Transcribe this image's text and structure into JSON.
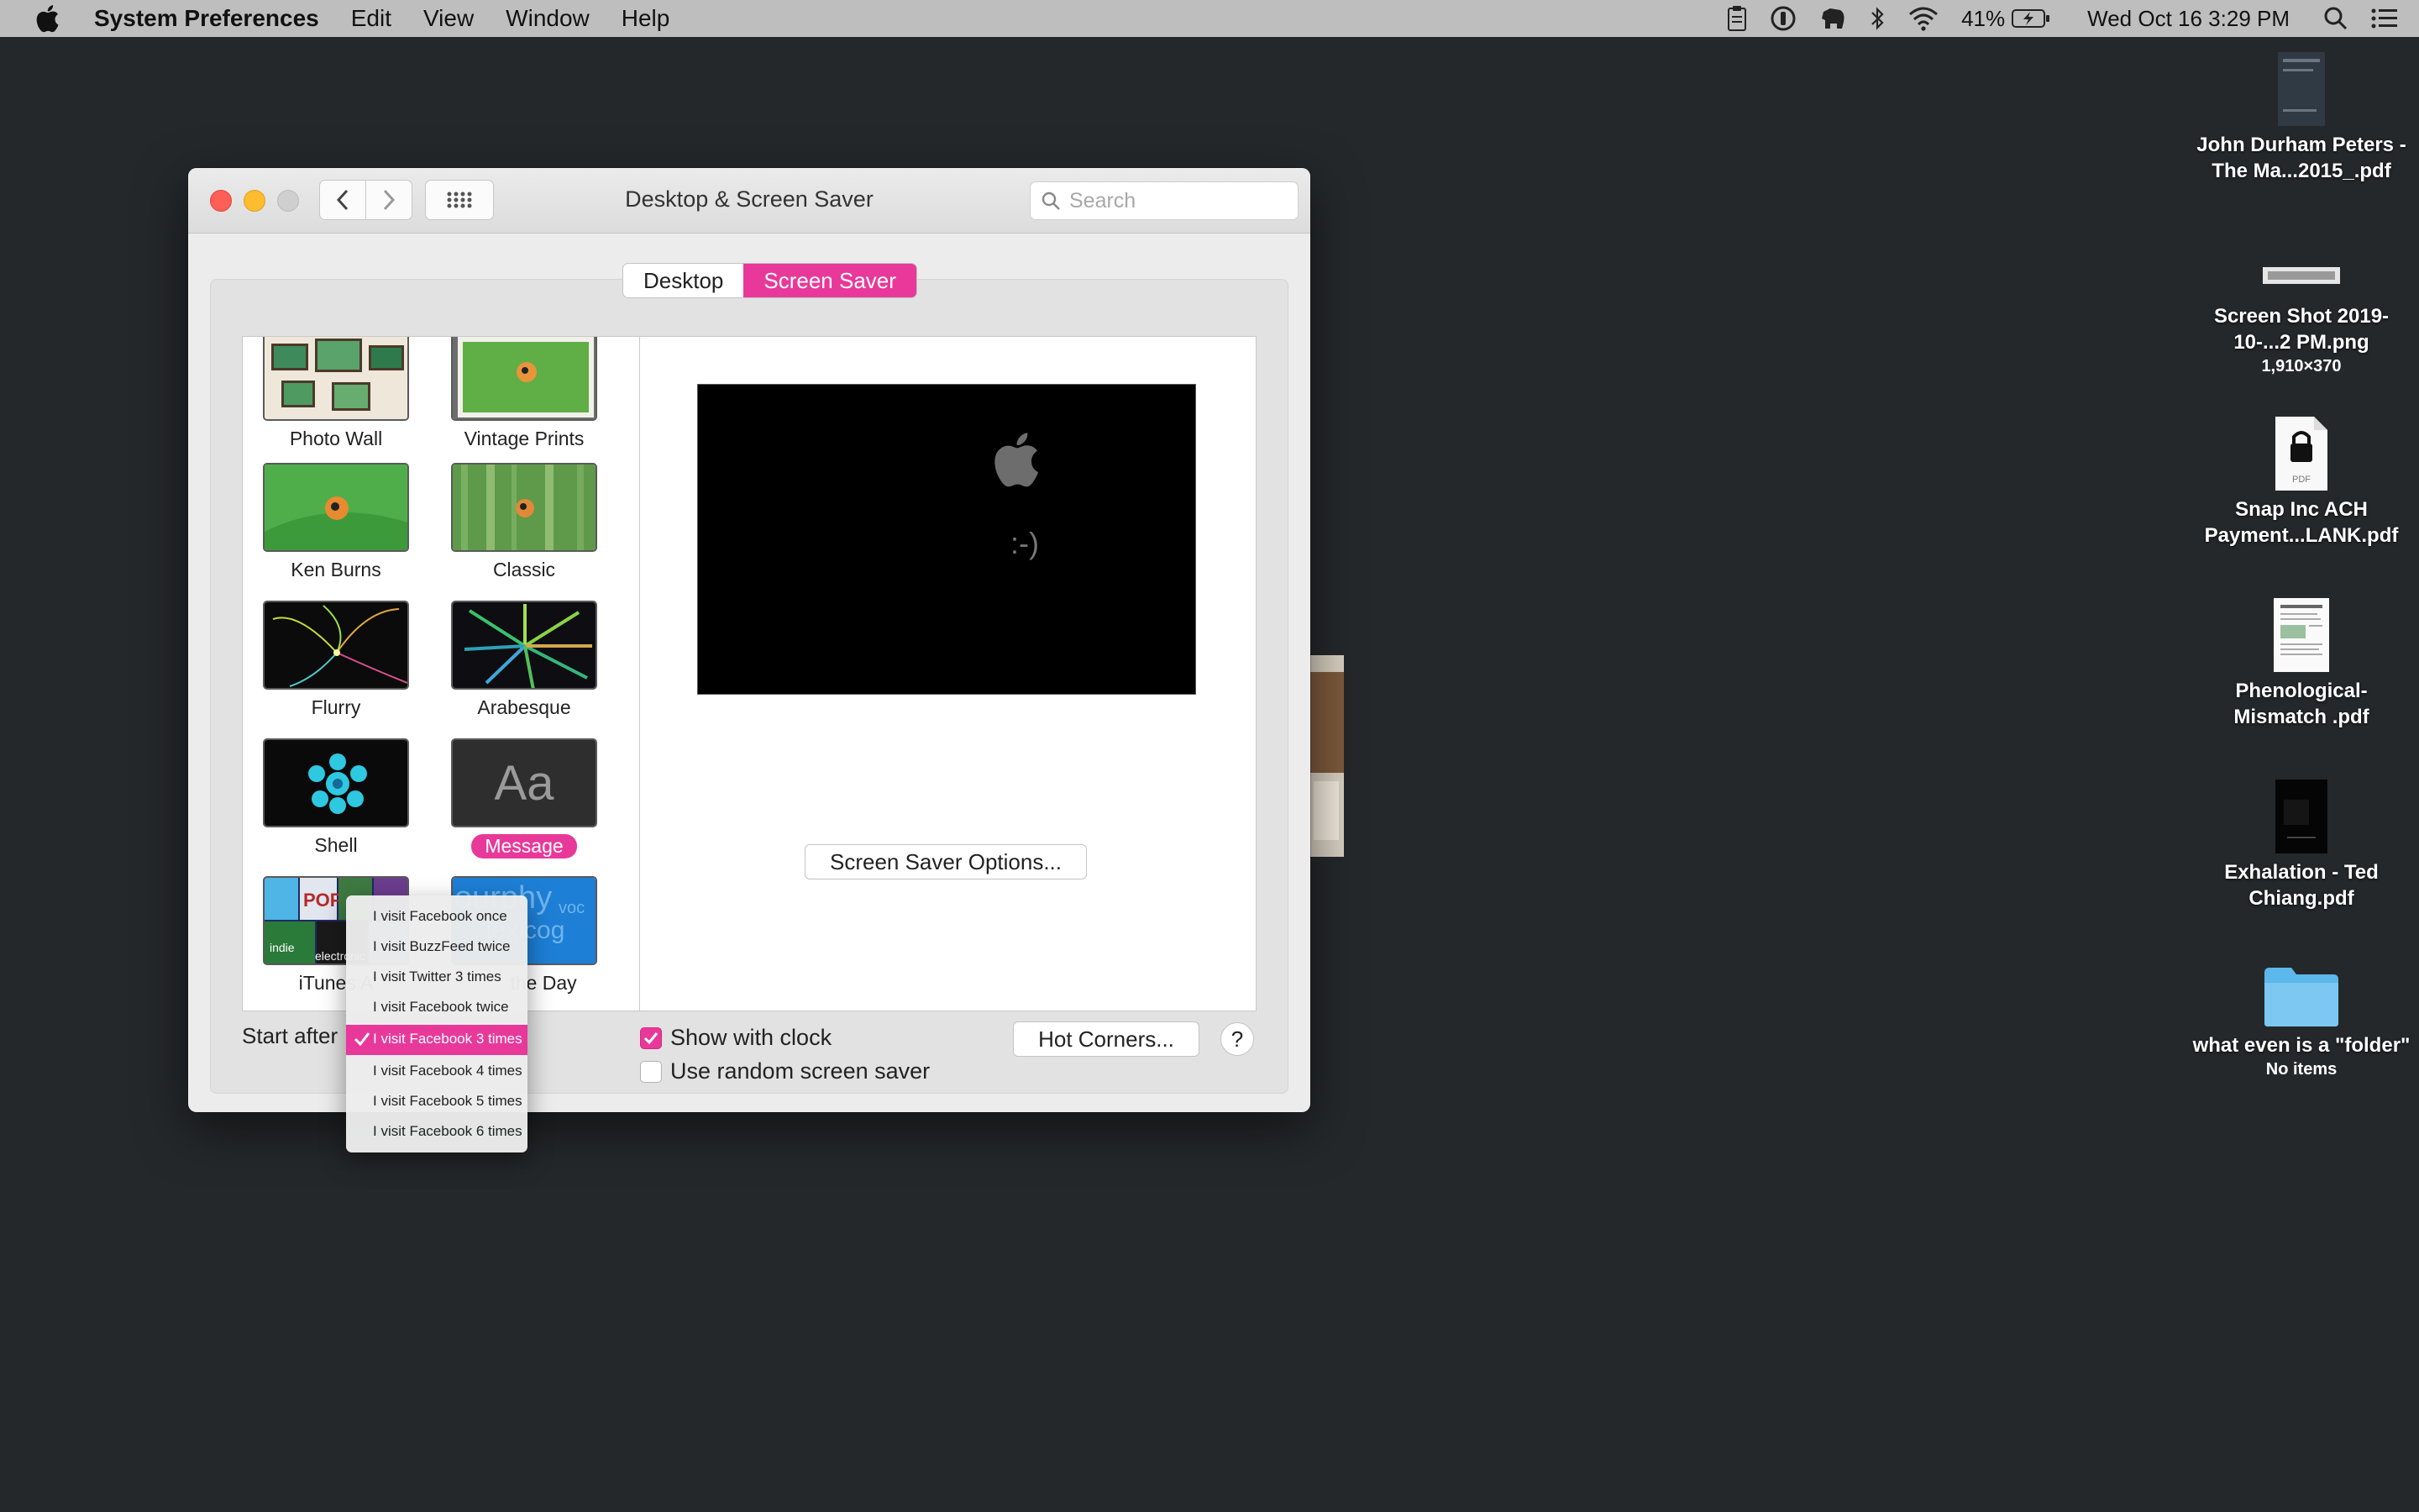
{
  "menubar": {
    "app_name": "System Preferences",
    "menus": [
      "Edit",
      "View",
      "Window",
      "Help"
    ],
    "battery": "41%",
    "datetime": "Wed Oct 16  3:29 PM"
  },
  "window": {
    "title": "Desktop & Screen Saver",
    "search_placeholder": "Search",
    "tabs": [
      {
        "label": "Desktop",
        "active": false
      },
      {
        "label": "Screen Saver",
        "active": true
      }
    ],
    "screensavers": [
      {
        "label": "Photo Wall"
      },
      {
        "label": "Vintage Prints"
      },
      {
        "label": "Ken Burns"
      },
      {
        "label": "Classic"
      },
      {
        "label": "Flurry"
      },
      {
        "label": "Arabesque"
      },
      {
        "label": "Shell"
      },
      {
        "label": "Message",
        "selected": true
      },
      {
        "label": "iTunes A"
      },
      {
        "label": "the Day"
      }
    ],
    "message_thumb_text": "Aa",
    "preview_message": ":-)",
    "options_button": "Screen Saver Options...",
    "start_after_label": "Start after",
    "show_clock_label": "Show with clock",
    "show_clock_checked": true,
    "random_label": "Use random screen saver",
    "random_checked": false,
    "hot_corners_button": "Hot Corners...",
    "help_button": "?",
    "accent_color": "#e8399a"
  },
  "dropdown": {
    "items": [
      {
        "label": "I visit Facebook once",
        "selected": false
      },
      {
        "label": "I visit BuzzFeed twice",
        "selected": false
      },
      {
        "label": "I visit Twitter 3 times",
        "selected": false
      },
      {
        "label": "I visit Facebook twice",
        "selected": false
      },
      {
        "label": "I visit Facebook 3 times",
        "selected": true
      },
      {
        "label": "I visit Facebook 4 times",
        "selected": false
      },
      {
        "label": "I visit Facebook 5 times",
        "selected": false
      },
      {
        "label": "I visit Facebook 6 times",
        "selected": false
      }
    ]
  },
  "desktop": {
    "items": [
      {
        "label": "John Durham Peters - The Ma...2015_.pdf",
        "sub": "",
        "icon": "pdf-document-icon"
      },
      {
        "label": "Screen Shot 2019-10-...2 PM.png",
        "sub": "1,910×370",
        "icon": "screenshot-file-icon"
      },
      {
        "label": "Snap Inc ACH Payment...LANK.pdf",
        "sub": "",
        "icon": "locked-pdf-icon"
      },
      {
        "label": "Phenological-Mismatch .pdf",
        "sub": "",
        "icon": "pdf-document-icon"
      },
      {
        "label": "Exhalation - Ted Chiang.pdf",
        "sub": "",
        "icon": "book-pdf-icon"
      },
      {
        "label": "what even is a \"folder\"",
        "sub": "No items",
        "icon": "folder-icon"
      }
    ],
    "locked_pdf_badge": "PDF"
  },
  "thumb_texts": {
    "itunes_pop": "POP",
    "itunes_electronic": "electronic",
    "itunes_indie": "indie",
    "word_line1": "ourphy",
    "word_line2": "lexicog",
    "word_side": "voc"
  }
}
